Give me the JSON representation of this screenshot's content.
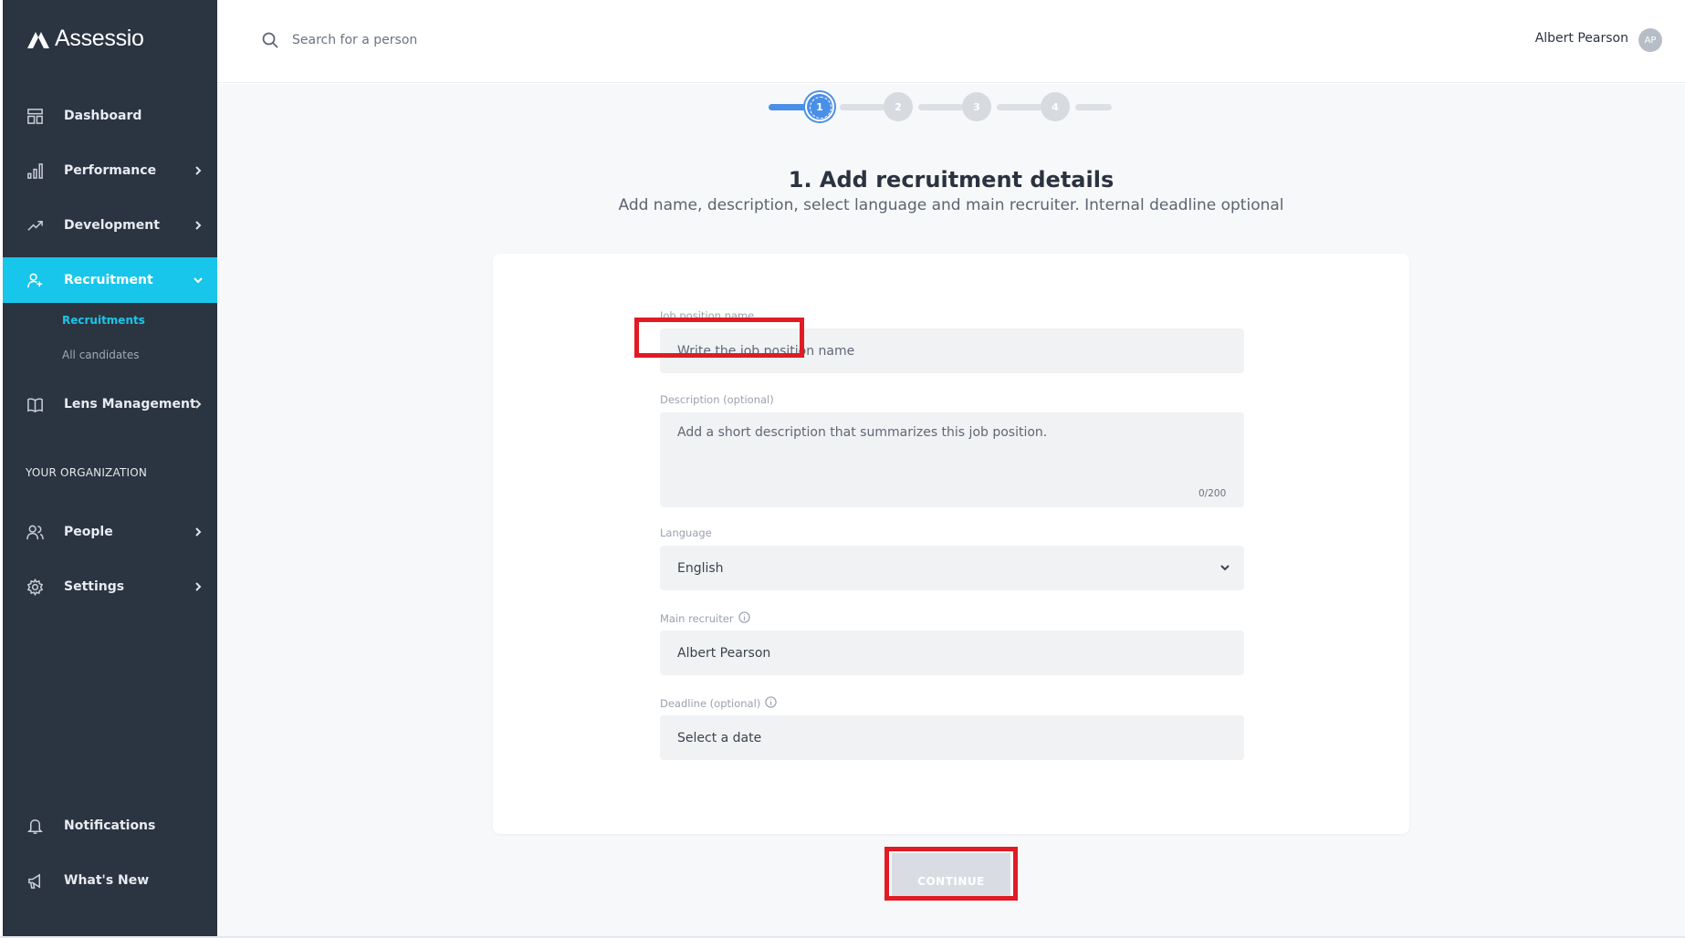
{
  "brand": {
    "name": "Assessio"
  },
  "sidebar": {
    "items": [
      {
        "label": "Dashboard",
        "icon": "dashboard-icon"
      },
      {
        "label": "Performance",
        "icon": "bar-chart-icon"
      },
      {
        "label": "Development",
        "icon": "trend-up-icon"
      },
      {
        "label": "Recruitment",
        "icon": "add-user-icon"
      },
      {
        "label": "Lens Management",
        "icon": "book-icon"
      },
      {
        "label": "People",
        "icon": "people-icon"
      },
      {
        "label": "Settings",
        "icon": "gear-icon"
      },
      {
        "label": "Notifications",
        "icon": "bell-icon"
      },
      {
        "label": "What's New",
        "icon": "megaphone-icon"
      }
    ],
    "sub_items": [
      {
        "label": "Recruitments",
        "active": true
      },
      {
        "label": "All candidates",
        "active": false
      }
    ],
    "section_label": "YOUR ORGANIZATION",
    "active_color": "#17c6ea",
    "background": "#2b3441"
  },
  "topbar": {
    "search_placeholder": "Search for a person",
    "user_name": "Albert Pearson",
    "avatar_initials": "AP"
  },
  "stepper": {
    "steps": [
      "1",
      "2",
      "3",
      "4"
    ],
    "current": 1,
    "accent": "#4a8fe7"
  },
  "page": {
    "title": "1. Add recruitment details",
    "subtitle": "Add name, description, select language and main recruiter. Internal deadline optional"
  },
  "form": {
    "job_label": "Job position name",
    "job_placeholder": "Write the job position name",
    "description_label": "Description (optional)",
    "description_placeholder": "Add a short description that summarizes this job position.",
    "description_counter": "0/200",
    "language_label": "Language",
    "language_value": "English",
    "recruiter_label": "Main recruiter",
    "recruiter_value": "Albert Pearson",
    "deadline_label": "Deadline (optional)",
    "deadline_placeholder": "Select a date"
  },
  "actions": {
    "continue_label": "CONTINUE"
  },
  "highlight_color": "#e01b24"
}
